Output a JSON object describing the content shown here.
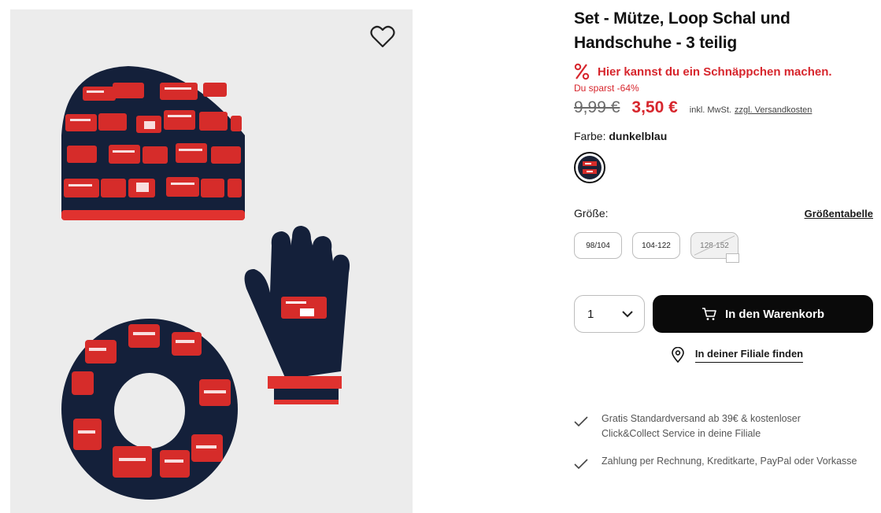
{
  "product": {
    "title_line1": "Set - Mütze, Loop Schal und",
    "title_line2": "Handschuhe - 3 teilig",
    "deal_text": "Hier kannst du ein Schnäppchen machen.",
    "savings_text": "Du sparst -64%",
    "old_price": "9,99 €",
    "new_price": "3,50 €",
    "tax_note": "inkl. MwSt.",
    "shipping_link": "zzgl. Versandkosten",
    "color_label": "Farbe:",
    "color_value": "dunkelblau",
    "size_label": "Größe:",
    "size_chart_link": "Größentabelle",
    "sizes": [
      {
        "label": "98/104",
        "available": true
      },
      {
        "label": "104-122",
        "available": true
      },
      {
        "label": "128-152",
        "available": false
      }
    ],
    "quantity": "1",
    "cart_button": "In den Warenkorb",
    "store_link": "In deiner Filiale finden",
    "benefits": [
      "Gratis Standardversand ab 39€ & kostenloser Click&Collect Service in deine Filiale",
      "Zahlung per Rechnung, Kreditkarte, PayPal oder Vorkasse"
    ]
  },
  "colors": {
    "accent_red": "#d7262d",
    "cart_button_bg": "#0a0a0a",
    "navy_knit": "#14203a"
  },
  "icons": [
    "heart-icon",
    "percent-icon",
    "cart-icon",
    "location-pin-icon",
    "check-icon",
    "chevron-down-icon"
  ]
}
